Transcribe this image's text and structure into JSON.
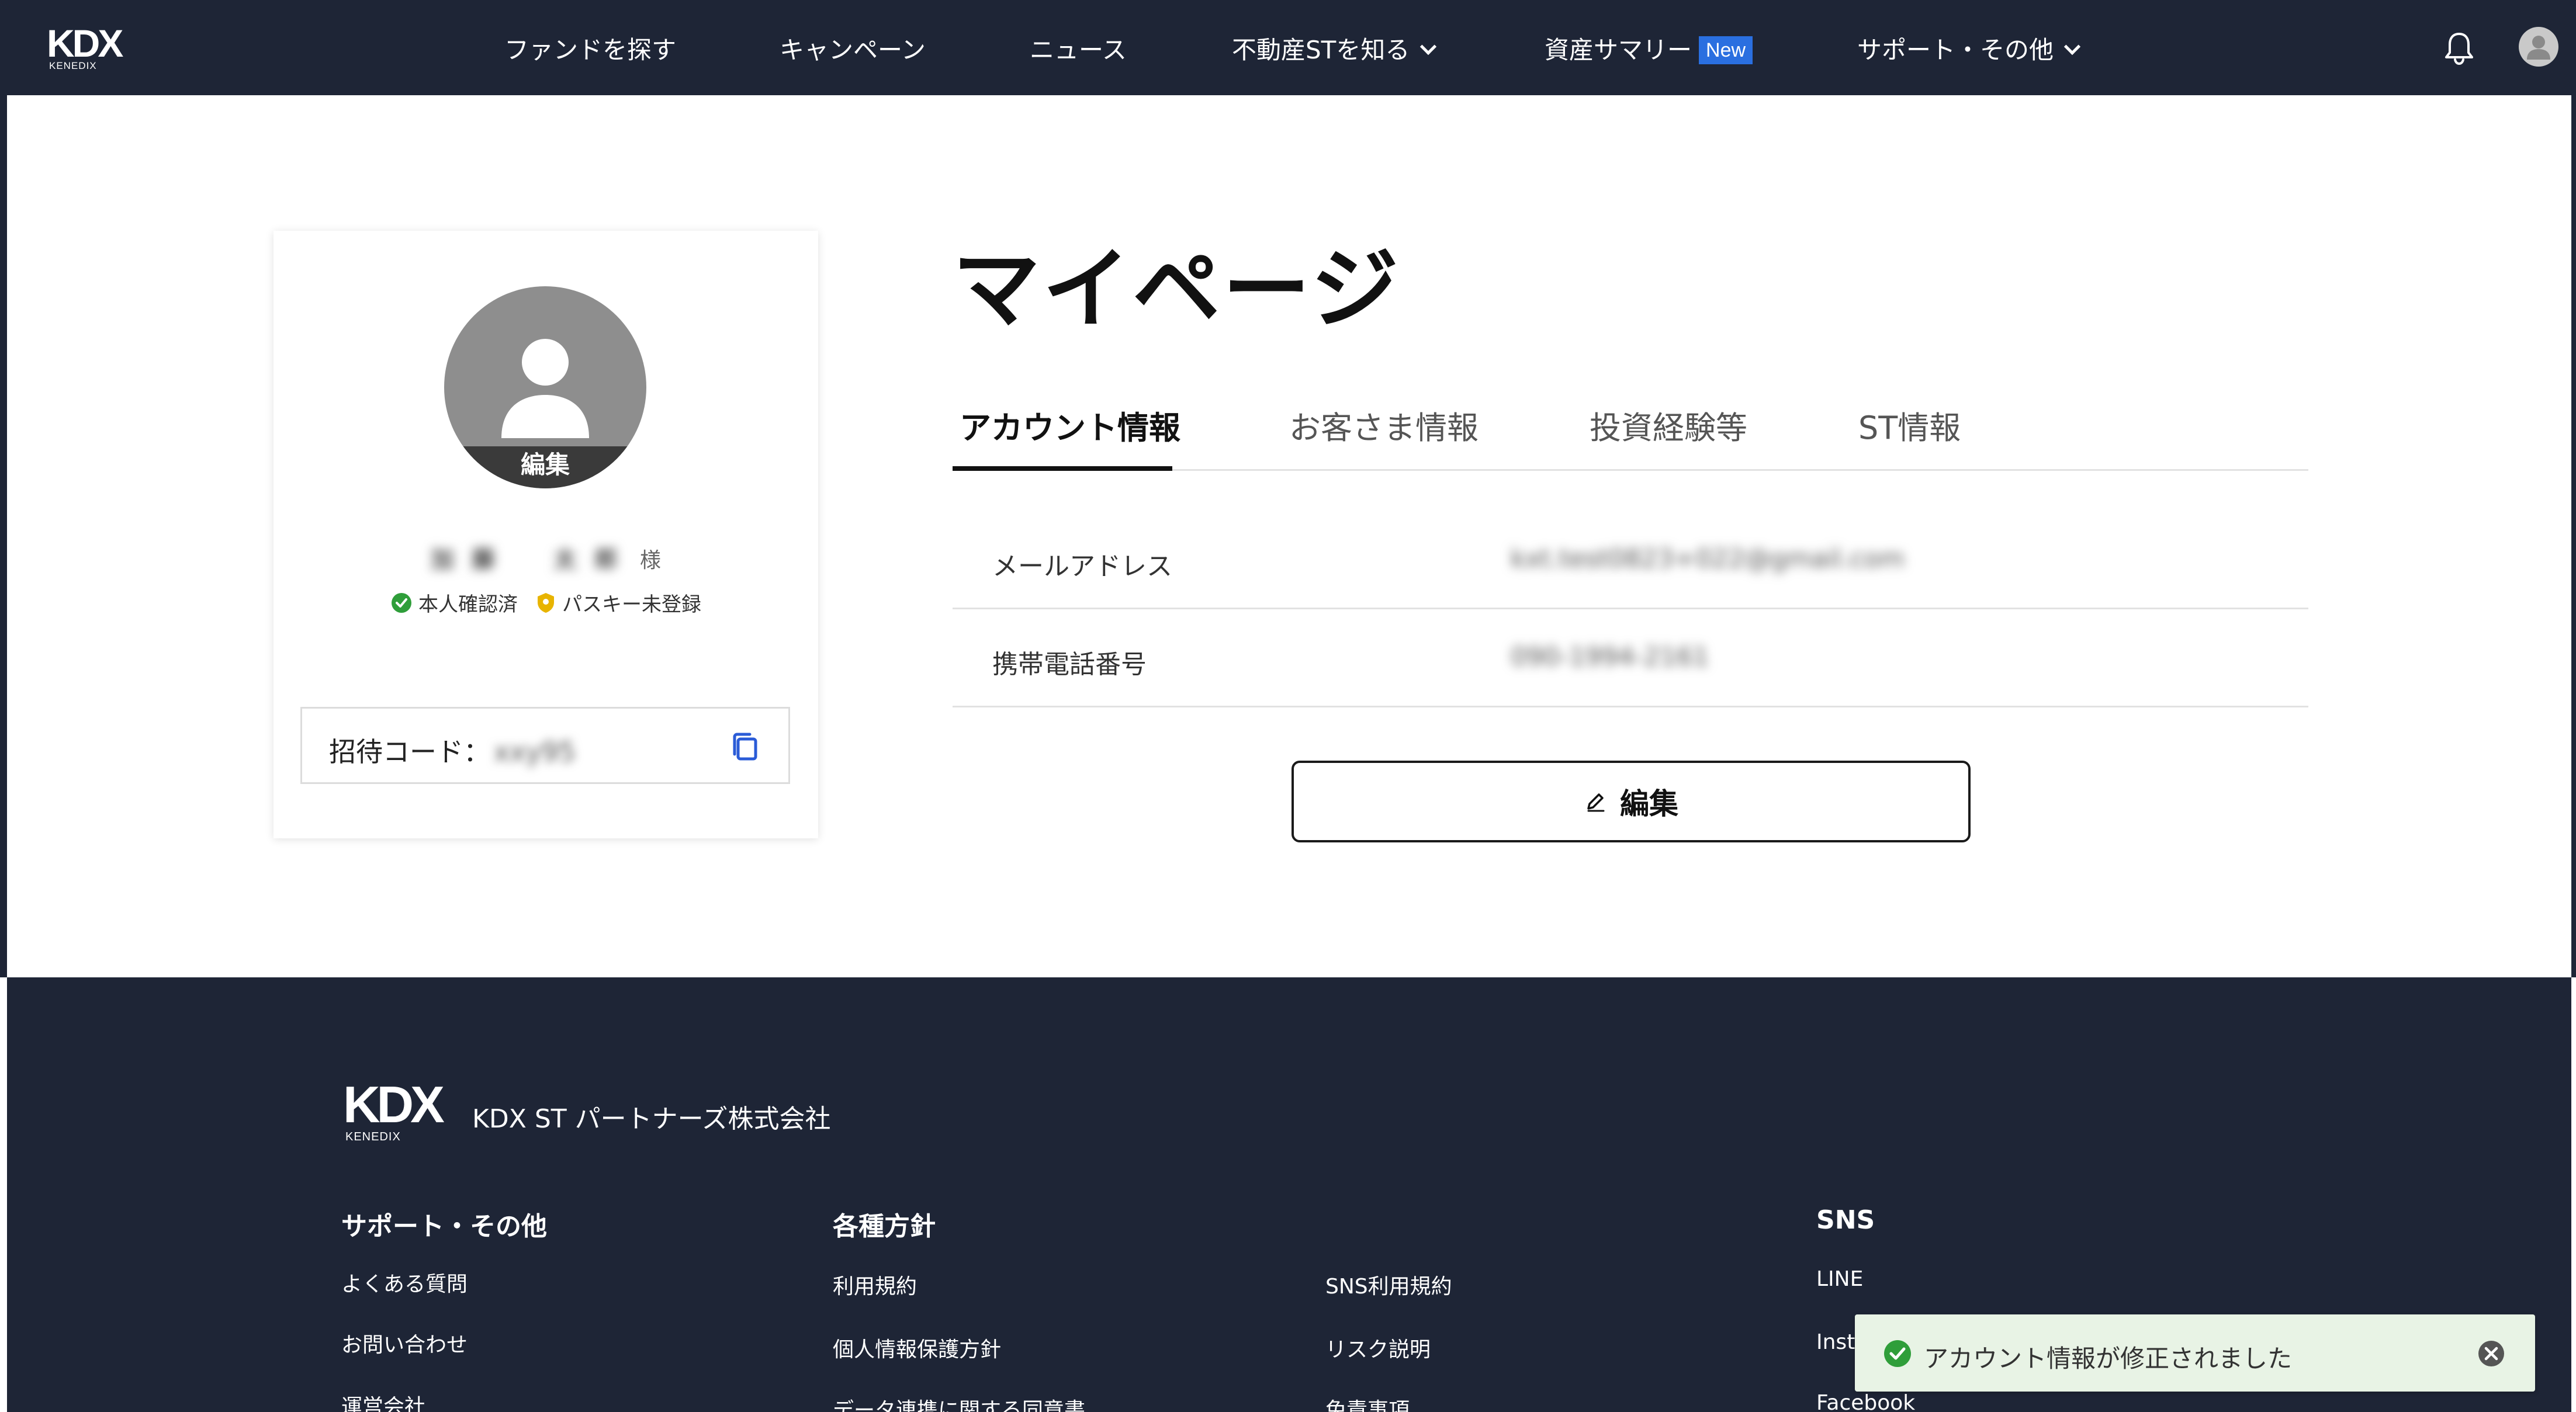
{
  "header": {
    "logo_text": "KDX",
    "logo_sub": "KENEDIX",
    "nav": [
      {
        "label": "ファンドを探す"
      },
      {
        "label": "キャンペーン"
      },
      {
        "label": "ニュース"
      },
      {
        "label": "不動産STを知る"
      },
      {
        "label": "資産サマリー",
        "badge": "New"
      },
      {
        "label": "サポート・その他"
      }
    ],
    "icons": [
      "bell-icon",
      "user-avatar-icon"
    ]
  },
  "profile": {
    "edit_label": "編集",
    "name": "加藤　太郎",
    "honorific": "様",
    "badges": {
      "identity": "本人確認済",
      "passkey": "パスキー未登録"
    },
    "invite_label": "招待コード：",
    "invite_code": "xxy95"
  },
  "page": {
    "title": "マイページ",
    "tabs": [
      {
        "label": "アカウント情報",
        "active": true
      },
      {
        "label": "お客さま情報",
        "active": false
      },
      {
        "label": "投資経験等",
        "active": false
      },
      {
        "label": "ST情報",
        "active": false
      }
    ],
    "rows": [
      {
        "label": "メールアドレス",
        "value": "kxt.test0823+022@gmail.com"
      },
      {
        "label": "携帯電話番号",
        "value": "090-1994-2161"
      }
    ],
    "edit_button": "編集"
  },
  "footer": {
    "logo_text": "KDX",
    "logo_sub": "KENEDIX",
    "company": "KDX ST パートナーズ株式会社",
    "columns": [
      {
        "title": "サポート・その他",
        "links": [
          "よくある質問",
          "お問い合わせ",
          "運営会社"
        ]
      },
      {
        "title": "各種方針",
        "links": [
          "利用規約",
          "個人情報保護方針",
          "データ連携に関する同意書"
        ]
      },
      {
        "title": "",
        "links": [
          "SNS利用規約",
          "リスク説明",
          "免責事項"
        ]
      },
      {
        "title": "SNS",
        "links": [
          "LINE",
          "Instagram",
          "Facebook"
        ]
      }
    ]
  },
  "toast": {
    "message": "アカウント情報が修正されました"
  },
  "colors": {
    "navy": "#1e2536",
    "new_badge": "#2a6fe0",
    "success": "#2f9e3a",
    "passkey": "#e8b400",
    "copy_icon": "#2a5bd7",
    "toast_bg": "#e8f3e5"
  }
}
